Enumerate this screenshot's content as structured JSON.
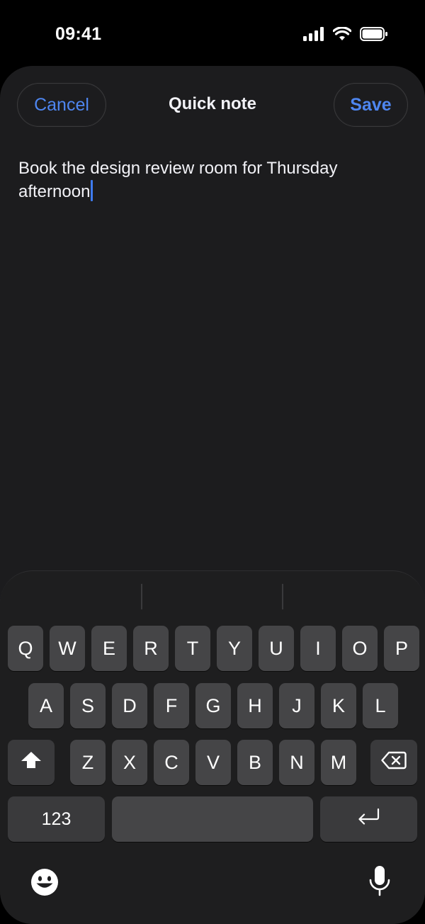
{
  "status": {
    "time": "09:41"
  },
  "sheet": {
    "cancel_label": "Cancel",
    "title": "Quick note",
    "save_label": "Save",
    "note_text": "Book the design review room for Thursday afternoon",
    "accent": "#4e86f0"
  },
  "keyboard": {
    "row1": [
      "Q",
      "W",
      "E",
      "R",
      "T",
      "Y",
      "U",
      "I",
      "O",
      "P"
    ],
    "row2": [
      "A",
      "S",
      "D",
      "F",
      "G",
      "H",
      "J",
      "K",
      "L"
    ],
    "row3": [
      "Z",
      "X",
      "C",
      "V",
      "B",
      "N",
      "M"
    ],
    "numbers_label": "123",
    "icons": {
      "shift": "shift-icon",
      "delete": "delete-icon",
      "return": "return-icon",
      "emoji": "emoji-icon",
      "dictation": "microphone-icon"
    }
  }
}
